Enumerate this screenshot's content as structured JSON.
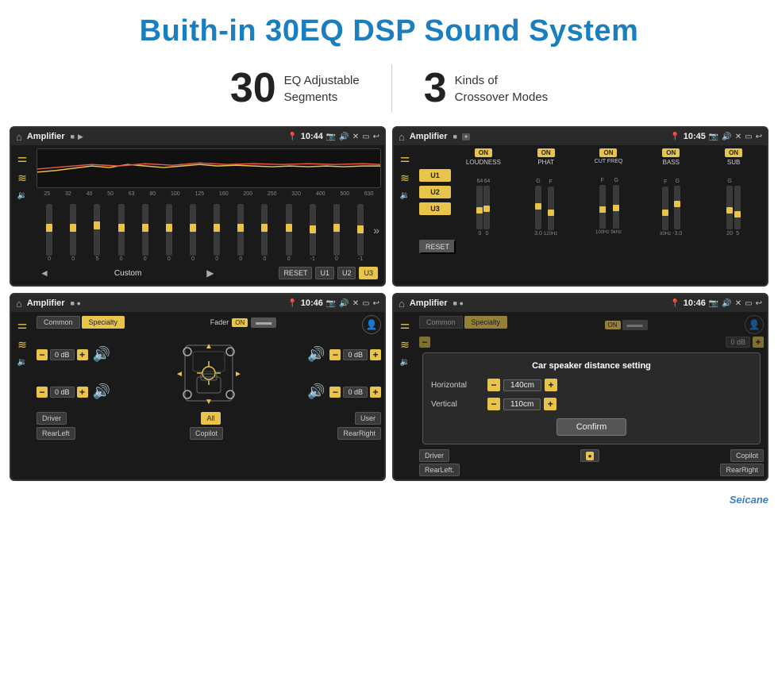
{
  "header": {
    "title": "Buith-in 30EQ DSP Sound System"
  },
  "stats": [
    {
      "number": "30",
      "desc_line1": "EQ Adjustable",
      "desc_line2": "Segments"
    },
    {
      "number": "3",
      "desc_line1": "Kinds of",
      "desc_line2": "Crossover Modes"
    }
  ],
  "screen1": {
    "title": "Amplifier",
    "time": "10:44",
    "eq_labels": [
      "25",
      "32",
      "40",
      "50",
      "63",
      "80",
      "100",
      "125",
      "160",
      "200",
      "250",
      "320",
      "400",
      "500",
      "630"
    ],
    "bottom_label": "Custom",
    "btn_reset": "RESET",
    "btn_u1": "U1",
    "btn_u2": "U2",
    "btn_u3": "U3"
  },
  "screen2": {
    "title": "Amplifier",
    "time": "10:45",
    "channels": [
      "LOUDNESS",
      "PHAT",
      "CUT FREQ",
      "BASS",
      "SUB"
    ],
    "btn_u1": "U1",
    "btn_u2": "U2",
    "btn_u3": "U3",
    "btn_reset": "RESET"
  },
  "screen3": {
    "title": "Amplifier",
    "time": "10:46",
    "tab_common": "Common",
    "tab_specialty": "Specialty",
    "fader_label": "Fader",
    "fader_on": "ON",
    "vol_values": [
      "0 dB",
      "0 dB",
      "0 dB",
      "0 dB"
    ],
    "btn_driver": "Driver",
    "btn_rearLeft": "RearLeft",
    "btn_all": "All",
    "btn_user": "User",
    "btn_copilot": "Copilot",
    "btn_rearRight": "RearRight"
  },
  "screen4": {
    "title": "Amplifier",
    "time": "10:46",
    "tab_common": "Common",
    "tab_specialty": "Specialty",
    "dialog_title": "Car speaker distance setting",
    "horizontal_label": "Horizontal",
    "horizontal_val": "140cm",
    "vertical_label": "Vertical",
    "vertical_val": "110cm",
    "confirm_btn": "Confirm",
    "vol_val1": "0 dB",
    "vol_val2": "0 dB",
    "btn_driver": "Driver",
    "btn_rearLeft": "RearLeft.",
    "btn_copilot": "Copilot",
    "btn_rearRight": "RearRight"
  },
  "footer": {
    "brand": "Seicane"
  },
  "icons": {
    "home": "⌂",
    "back": "↩",
    "eq_filter": "≡",
    "waveform": "∿",
    "volume": "🔊",
    "person": "👤",
    "arrow_up": "▲",
    "arrow_down": "▼",
    "arrow_left": "◄",
    "arrow_right": "►",
    "play": "▶",
    "prev": "◄",
    "chevron_right": "»"
  }
}
